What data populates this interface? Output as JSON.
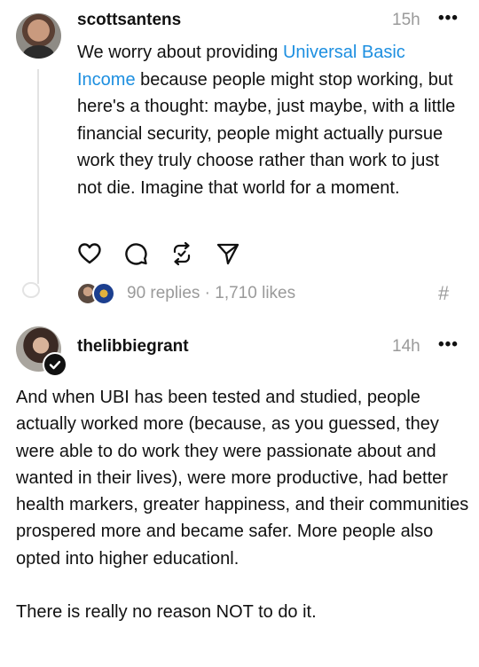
{
  "post": {
    "username": "scottsantens",
    "time": "15h",
    "more": "•••",
    "text_before_link": "We worry about providing ",
    "link_text": "Universal Basic Income",
    "text_after_link": " because people might stop working, but here's a thought: maybe, just maybe, with a little financial security, people might actually pursue work they truly choose rather than work to just not die. Imagine that world for a moment.",
    "replies_likes": "90 replies · 1,710 likes",
    "hash": "#"
  },
  "reply": {
    "username": "thelibbiegrant",
    "time": "14h",
    "more": "•••",
    "paragraph1": "And when UBI has been tested and studied, people actually worked more (because, as you guessed, they were able to do work they were passionate about and wanted in their lives), were more productive, had better health markers, greater happiness, and their communities prospered more and became safer. More people also opted into higher educationl.",
    "paragraph2": "There is really no reason NOT to do it."
  },
  "icons": {
    "like": "heart-icon",
    "comment": "comment-bubble-icon",
    "repost": "repost-icon",
    "share": "send-icon",
    "verified": "verified-check-icon"
  },
  "colors": {
    "link": "#1d8fe0",
    "muted": "#9a9a9a",
    "text": "#111111",
    "thread_line": "#e3e3e3"
  }
}
